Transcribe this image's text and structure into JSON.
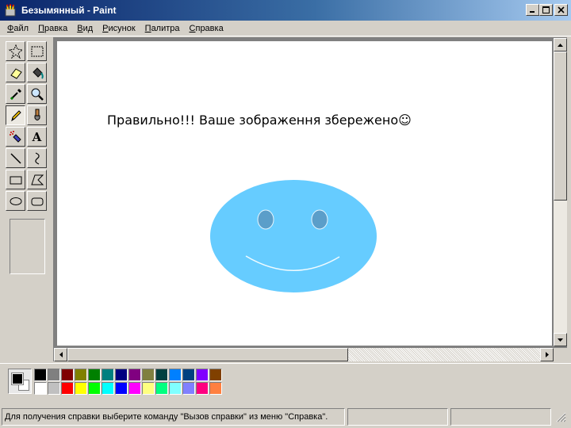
{
  "window": {
    "title": "Безымянный - Paint",
    "icon": "paint-app-icon",
    "controls": [
      "minimize-icon",
      "maximize-icon",
      "close-icon"
    ]
  },
  "menu": [
    {
      "label": "Файл",
      "accel": "Ф",
      "rest": "айл"
    },
    {
      "label": "Правка",
      "accel": "П",
      "rest": "равка"
    },
    {
      "label": "Вид",
      "accel": "В",
      "rest": "ид"
    },
    {
      "label": "Рисунок",
      "accel": "Р",
      "rest": "исунок"
    },
    {
      "label": "Палитра",
      "accel": "П",
      "rest": "алитра"
    },
    {
      "label": "Справка",
      "accel": "С",
      "rest": "правка"
    }
  ],
  "tools": [
    {
      "name": "free-form-select",
      "icon": "star-select-icon"
    },
    {
      "name": "rect-select",
      "icon": "rect-select-icon"
    },
    {
      "name": "eraser",
      "icon": "eraser-icon"
    },
    {
      "name": "fill",
      "icon": "paint-bucket-icon"
    },
    {
      "name": "pick-color",
      "icon": "eyedropper-icon"
    },
    {
      "name": "magnifier",
      "icon": "magnifier-icon"
    },
    {
      "name": "pencil",
      "icon": "pencil-icon",
      "active": true
    },
    {
      "name": "brush",
      "icon": "brush-icon"
    },
    {
      "name": "airbrush",
      "icon": "airbrush-icon"
    },
    {
      "name": "text",
      "icon": "text-icon",
      "glyph": "A"
    },
    {
      "name": "line",
      "icon": "line-icon"
    },
    {
      "name": "curve",
      "icon": "curve-icon"
    },
    {
      "name": "rectangle",
      "icon": "rectangle-icon"
    },
    {
      "name": "polygon",
      "icon": "polygon-icon"
    },
    {
      "name": "ellipse",
      "icon": "ellipse-icon"
    },
    {
      "name": "rounded-rectangle",
      "icon": "rounded-rect-icon"
    }
  ],
  "canvas": {
    "text": "Правильно!!! Ваше зображення збережено☺",
    "smiley_color": "#66ccff",
    "eye_color": "#5b9ec9"
  },
  "palette": {
    "foreground": "#000000",
    "background": "#ffffff",
    "row1": [
      "#000000",
      "#808080",
      "#800000",
      "#808000",
      "#008000",
      "#008080",
      "#000080",
      "#800080",
      "#808040",
      "#004040",
      "#0080ff",
      "#004080",
      "#8000ff",
      "#804000"
    ],
    "row2": [
      "#ffffff",
      "#c0c0c0",
      "#ff0000",
      "#ffff00",
      "#00ff00",
      "#00ffff",
      "#0000ff",
      "#ff00ff",
      "#ffff80",
      "#00ff80",
      "#80ffff",
      "#8080ff",
      "#ff0080",
      "#ff8040"
    ]
  },
  "status": {
    "message": "Для получения справки выберите команду \"Вызов справки\" из меню \"Справка\".",
    "coords": "",
    "size": ""
  }
}
